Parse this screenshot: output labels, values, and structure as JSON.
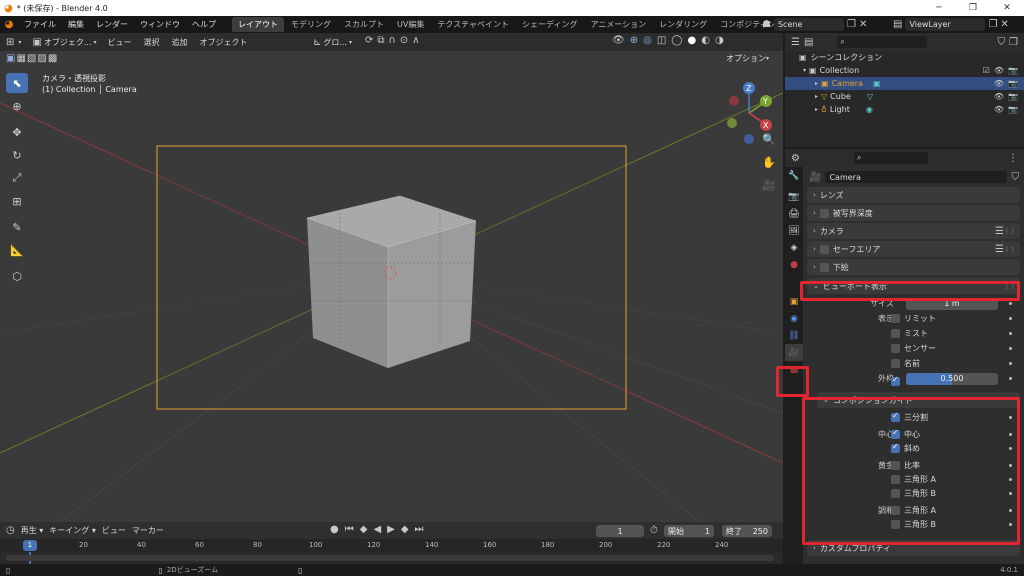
{
  "window": {
    "title": "* (未保存) - Blender 4.0"
  },
  "menu": {
    "items": [
      "ファイル",
      "編集",
      "レンダー",
      "ウィンドウ",
      "ヘルプ"
    ]
  },
  "workspaces": {
    "tabs": [
      "レイアウト",
      "モデリング",
      "スカルプト",
      "UV編集",
      "テクスチャペイント",
      "シェーディング",
      "アニメーション",
      "レンダリング",
      "コンポジティング"
    ],
    "active": "レイアウト"
  },
  "scene": {
    "name": "Scene",
    "view_layer": "ViewLayer"
  },
  "viewport_header": {
    "mode": "オブジェク...",
    "menus": [
      "ビュー",
      "選択",
      "追加",
      "オブジェクト"
    ],
    "transform": "グロ...",
    "options": "オプション"
  },
  "viewport_label": {
    "line1": "カメラ・透視投影",
    "line2": "(1) Collection │ Camera"
  },
  "gizmo": {
    "z": "Z",
    "y": "Y",
    "x": "X"
  },
  "outliner": {
    "root": "シーンコレクション",
    "collection": "Collection",
    "items": [
      "Camera",
      "Cube",
      "Light"
    ]
  },
  "properties": {
    "object_name": "Camera",
    "panels": {
      "lens": "レンズ",
      "dof": "被写界深度",
      "camera": "カメラ",
      "safe_area": "セーフエリア",
      "background": "下絵",
      "viewport_display": "ビューポート表示",
      "composition": "コンポジションガイド",
      "custom": "カスタムプロパティ"
    },
    "viewport_display": {
      "size_label": "サイズ",
      "size_value": "1 m",
      "show_label": "表示",
      "limits": "リミット",
      "mist": "ミスト",
      "sensor": "センサー",
      "name": "名前",
      "passepartout_label": "外枠",
      "passepartout_value": "0.500",
      "passepartout_fraction": 0.5
    },
    "composition": {
      "thirds": "三分割",
      "center_label": "中心",
      "center": "中心",
      "diagonal": "斜め",
      "golden_label": "黄金",
      "ratio": "比率",
      "triangle_a": "三角形 A",
      "triangle_b": "三角形 B",
      "harmony_label": "調和",
      "h_triangle_a": "三角形 A",
      "h_triangle_b": "三角形 B"
    }
  },
  "timeline": {
    "menus": [
      "再生",
      "キーイング",
      "ビュー",
      "マーカー"
    ],
    "current_frame": "1",
    "start_label": "開始",
    "start": "1",
    "end_label": "終了",
    "end": "250",
    "ticks": [
      "1",
      "20",
      "40",
      "60",
      "80",
      "100",
      "120",
      "140",
      "160",
      "180",
      "200",
      "220",
      "240"
    ]
  },
  "status": {
    "hint": "2Dビューズーム",
    "version": "4.0.1"
  },
  "colors": {
    "accent": "#4772b3",
    "highlight_box": "#e3262e",
    "camera_frame": "#e8a035"
  }
}
